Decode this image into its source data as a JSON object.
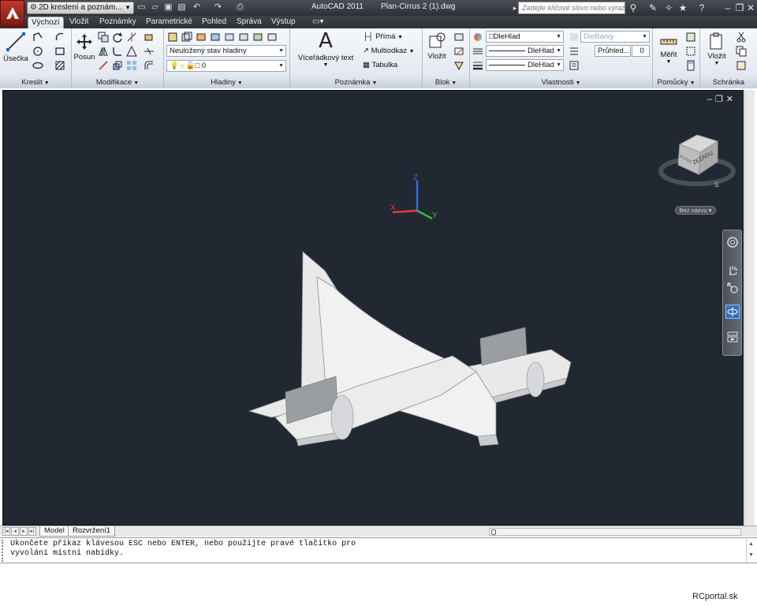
{
  "titlebar": {
    "workspace": "2D kreslení a poznám...",
    "app_name": "AutoCAD 2011",
    "file_name": "Plan-Cirrus 2 (1).dwg",
    "search_placeholder": "Zadejte klíčové slovo nebo výraz."
  },
  "tabs": [
    "Výchozí",
    "Vložit",
    "Poznámky",
    "Parametrické",
    "Pohled",
    "Správa",
    "Výstup"
  ],
  "ribbon": {
    "kreslit": {
      "title": "Kreslit",
      "usecka": "Úsečka"
    },
    "modifikace": {
      "title": "Modifikace",
      "posun": "Posun"
    },
    "hladiny": {
      "title": "Hladiny",
      "layer_state": "Neuložený stav hladiny",
      "current_layer": "0"
    },
    "poznamka": {
      "title": "Poznámka",
      "mtext": "Víceřádkový text",
      "prima": "Přímá",
      "multiodkaz": "Multiodkaz",
      "tabulka": "Tabulka"
    },
    "blok": {
      "title": "Blok",
      "vlozit": "Vložit"
    },
    "vlastnosti": {
      "title": "Vlastnosti",
      "color": "DleHlad",
      "linetype": "DleHlad",
      "lineweight": "DleHlad",
      "plotstyle": "DleBarvy",
      "transparency_label": "Průhled...",
      "transparency_value": "0"
    },
    "pomucky": {
      "title": "Pomůcky",
      "merit": "Měřit"
    },
    "schranka": {
      "title": "Schránka",
      "vlozit": "Vložit"
    }
  },
  "viewport": {
    "viewcube_face": "ZEZADU",
    "viewcube_side": "VLEVO",
    "viewcube_compass": "S",
    "ucs_label": "Bez názvu",
    "axes": {
      "x": "X",
      "y": "Y",
      "z": "Z"
    }
  },
  "layout_tabs": [
    "Model",
    "Rozvržení1"
  ],
  "command_line": {
    "line1": "Ukončete příkaz klávesou ESC nebo ENTER, nebo použijte pravé tlačítko pro",
    "line2": "vyvolání místní nabídky."
  },
  "watermark": "RCportal.sk"
}
